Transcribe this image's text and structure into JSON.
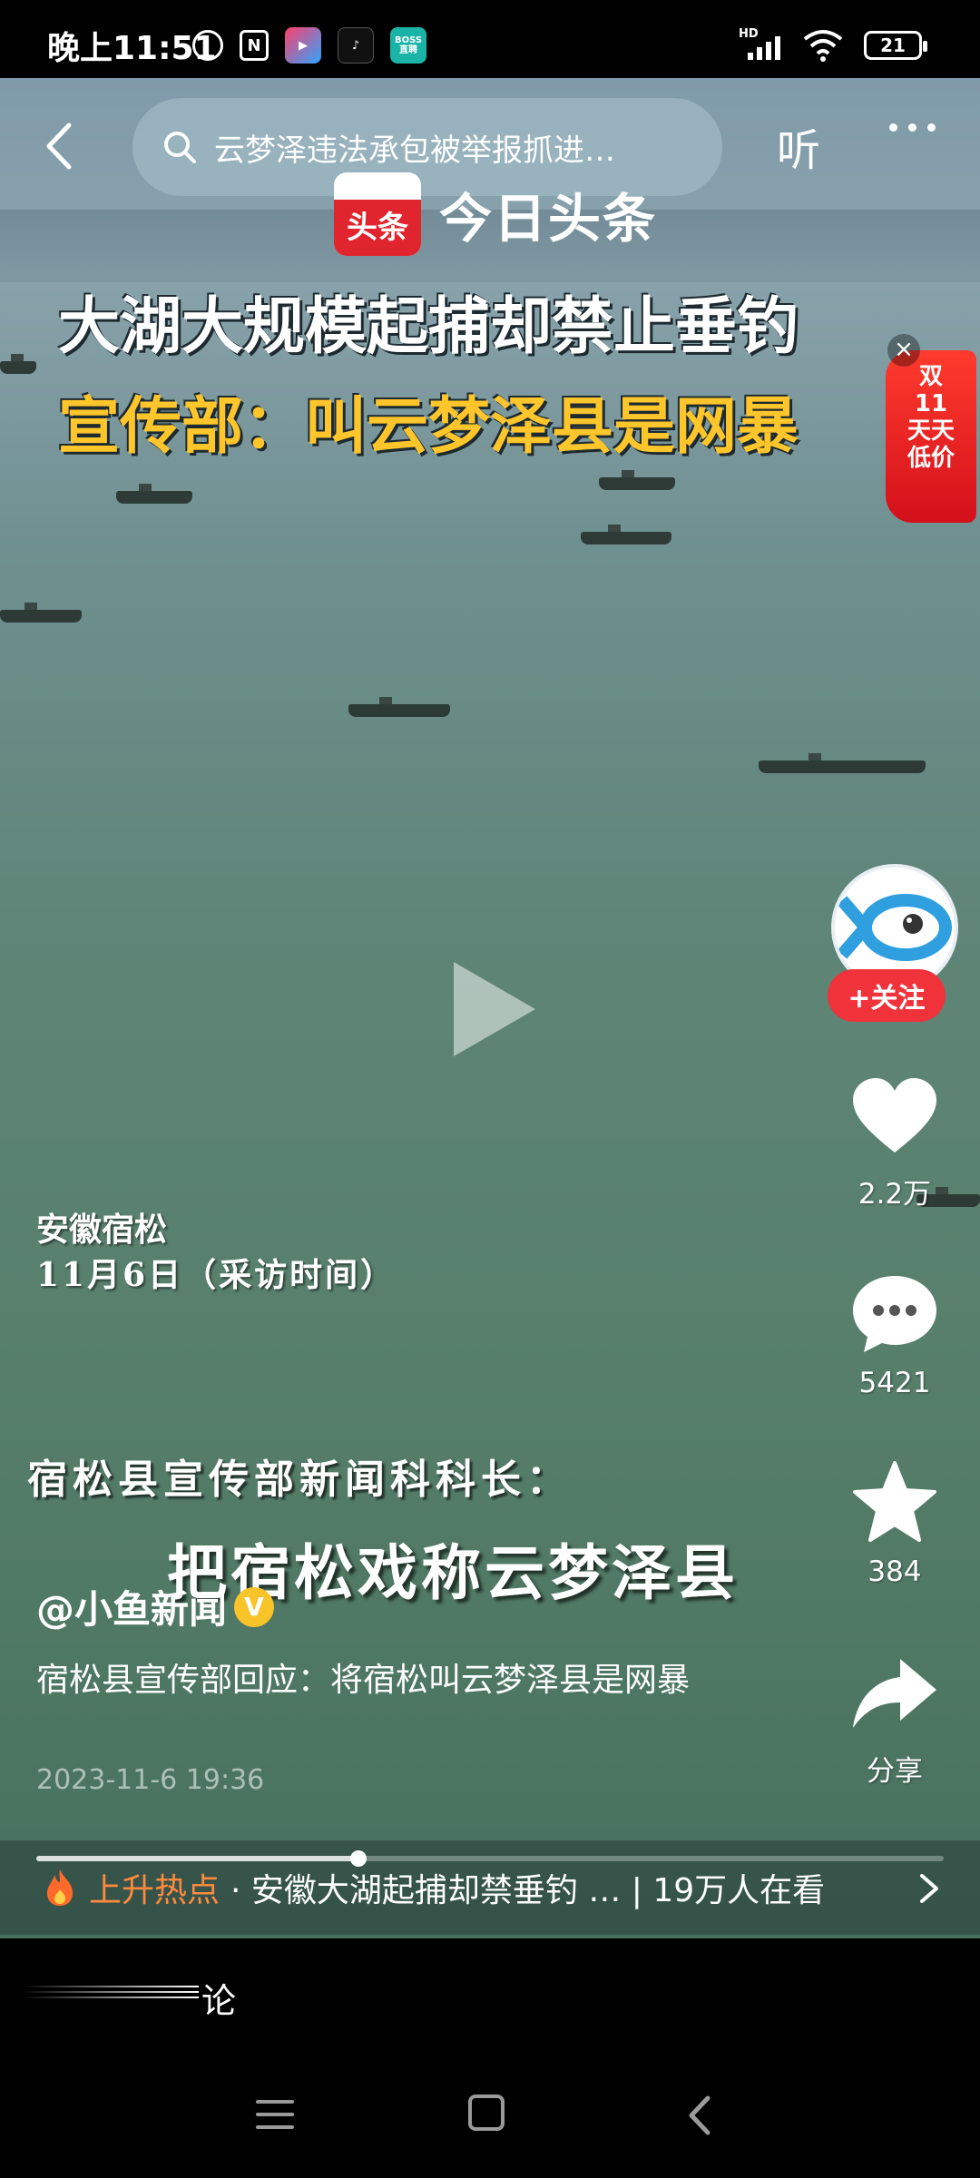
{
  "status_bar": {
    "time": "晚上11:51",
    "app_icons": [
      "alarm-icon",
      "nfc-icon",
      "video-app-icon",
      "tiktok-icon",
      "boss-app-icon"
    ],
    "boss_label": "BOSS\n直聘",
    "network": "HD",
    "battery": "21"
  },
  "top_bar": {
    "search_text": "云梦泽违法承包被举报抓进…",
    "listen_label": "听"
  },
  "video": {
    "brand_badge": "头条",
    "brand_name": "今日头条",
    "headline_1": "大湖大规模起捕却禁止垂钓",
    "headline_2": "宣传部：叫云梦泽县是网暴",
    "location": "安徽宿松",
    "interview_date": "11月6日（采访时间）",
    "subtitle_speaker": "宿松县宣传部新闻科科长：",
    "subtitle_quote": "把宿松戏称云梦泽县",
    "promo": [
      "双",
      "11",
      "天天",
      "低价"
    ]
  },
  "rail": {
    "follow_label": "+关注",
    "likes": "2.2万",
    "comments": "5421",
    "favorites": "384",
    "share_label": "分享"
  },
  "post": {
    "author": "@小鱼新闻",
    "verified_mark": "V",
    "description": "宿松县宣传部回应：将宿松叫云梦泽县是网暴",
    "date": "2023-11-6 19:36"
  },
  "hot": {
    "label": "上升热点",
    "text": "· 安徽大湖起捕却禁垂钓 … | 19万人在看"
  },
  "progress": {
    "played_fraction": 0.355
  },
  "comment_bar": {
    "label": "论"
  },
  "colors": {
    "accent_red": "#f0323b",
    "hot_orange": "#ff8a3d",
    "headline_yellow": "#ffc62b",
    "verified_yellow": "#f9c32a"
  }
}
